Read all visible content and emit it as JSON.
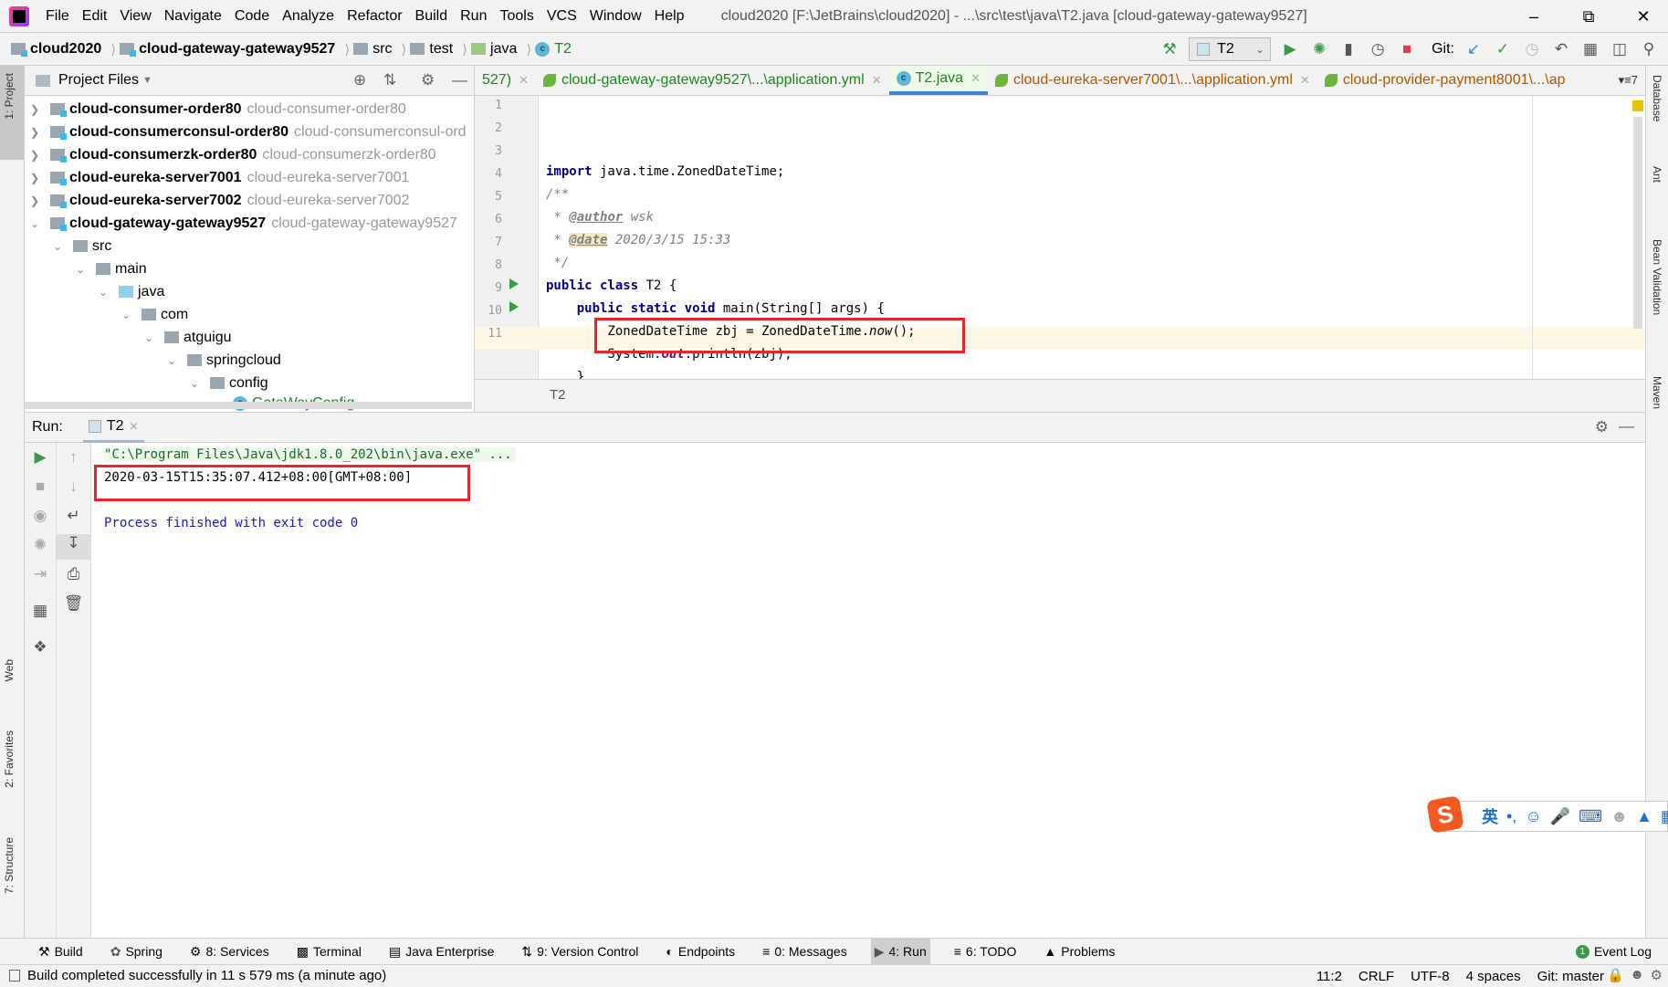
{
  "menu": {
    "items": [
      "File",
      "Edit",
      "View",
      "Navigate",
      "Code",
      "Analyze",
      "Refactor",
      "Build",
      "Run",
      "Tools",
      "VCS",
      "Window",
      "Help"
    ],
    "title": "cloud2020 [F:\\JetBrains\\cloud2020] - ...\\src\\test\\java\\T2.java [cloud-gateway-gateway9527]"
  },
  "breadcrumb": [
    "cloud2020",
    "cloud-gateway-gateway9527",
    "src",
    "test",
    "java",
    "T2"
  ],
  "toolbar": {
    "run_config": "T2",
    "git_label": "Git:"
  },
  "left_strip": {
    "project": "1: Project",
    "web": "Web",
    "favorites": "2: Favorites",
    "structure": "7: Structure"
  },
  "right_strip": {
    "database": "Database",
    "ant": "Ant",
    "bean": "Bean Validation",
    "maven": "Maven"
  },
  "project": {
    "header": "Project Files",
    "modules": [
      {
        "name": "cloud-consumer-order80",
        "hint": "cloud-consumer-order80"
      },
      {
        "name": "cloud-consumerconsul-order80",
        "hint": "cloud-consumerconsul-ord"
      },
      {
        "name": "cloud-consumerzk-order80",
        "hint": "cloud-consumerzk-order80"
      },
      {
        "name": "cloud-eureka-server7001",
        "hint": "cloud-eureka-server7001"
      },
      {
        "name": "cloud-eureka-server7002",
        "hint": "cloud-eureka-server7002"
      },
      {
        "name": "cloud-gateway-gateway9527",
        "hint": "cloud-gateway-gateway9527"
      }
    ],
    "folders": [
      "src",
      "main",
      "java",
      "com",
      "atguigu",
      "springcloud",
      "config"
    ],
    "file": "GateWayConfig"
  },
  "tabs": [
    {
      "label": "527)",
      "color": "green"
    },
    {
      "label": "cloud-gateway-gateway9527\\...\\application.yml",
      "color": "green"
    },
    {
      "label": "T2.java",
      "color": "green",
      "active": true
    },
    {
      "label": "cloud-eureka-server7001\\...\\application.yml",
      "color": "orange"
    },
    {
      "label": "cloud-provider-payment8001\\...\\ap",
      "color": "orange"
    }
  ],
  "tabs_overflow": "7",
  "editor": {
    "line_numbers": [
      "1",
      "2",
      "3",
      "4",
      "5",
      "6",
      "7",
      "8",
      "9",
      "10",
      "11"
    ],
    "lines": {
      "l1a": "import",
      "l1b": " java.time.ZonedDateTime;",
      "l2": "/**",
      "l3a": " * ",
      "l3b": "@author",
      "l3c": " wsk",
      "l4a": " * ",
      "l4b": "@date",
      "l4c": " 2020/3/15 15:33",
      "l5": " */",
      "l6a": "public class",
      "l6b": " T2 {",
      "l7a": "    public static void",
      "l7b": " main(String[] args) {",
      "l8a": "        ZonedDateTime zbj = ZonedDateTime.",
      "l8b": "now",
      "l8c": "();",
      "l9a": "        System.",
      "l9b": "out",
      "l9c": ".println(zbj);",
      "l10": "    }",
      "l11": "}"
    },
    "footer": "T2"
  },
  "run": {
    "label": "Run:",
    "tab": "T2",
    "command": "\"C:\\Program Files\\Java\\jdk1.8.0_202\\bin\\java.exe\" ...",
    "output": "2020-03-15T15:35:07.412+08:00[GMT+08:00]",
    "exit": "Process finished with exit code 0"
  },
  "ime": {
    "lang": "英"
  },
  "bottom_tools": [
    "Build",
    "Spring",
    "8: Services",
    "Terminal",
    "Java Enterprise",
    "9: Version Control",
    "Endpoints",
    "0: Messages",
    "4: Run",
    "6: TODO",
    "Problems"
  ],
  "event_log": "Event Log",
  "status": {
    "message": "Build completed successfully in 11 s 579 ms (a minute ago)",
    "position": "11:2",
    "line_sep": "CRLF",
    "encoding": "UTF-8",
    "indent": "4 spaces",
    "git": "Git: master"
  },
  "colors": {
    "accent": "#4083c9",
    "highlight_box": "#e8262b",
    "run_green": "#3d9a48",
    "keyword": "#000080"
  }
}
